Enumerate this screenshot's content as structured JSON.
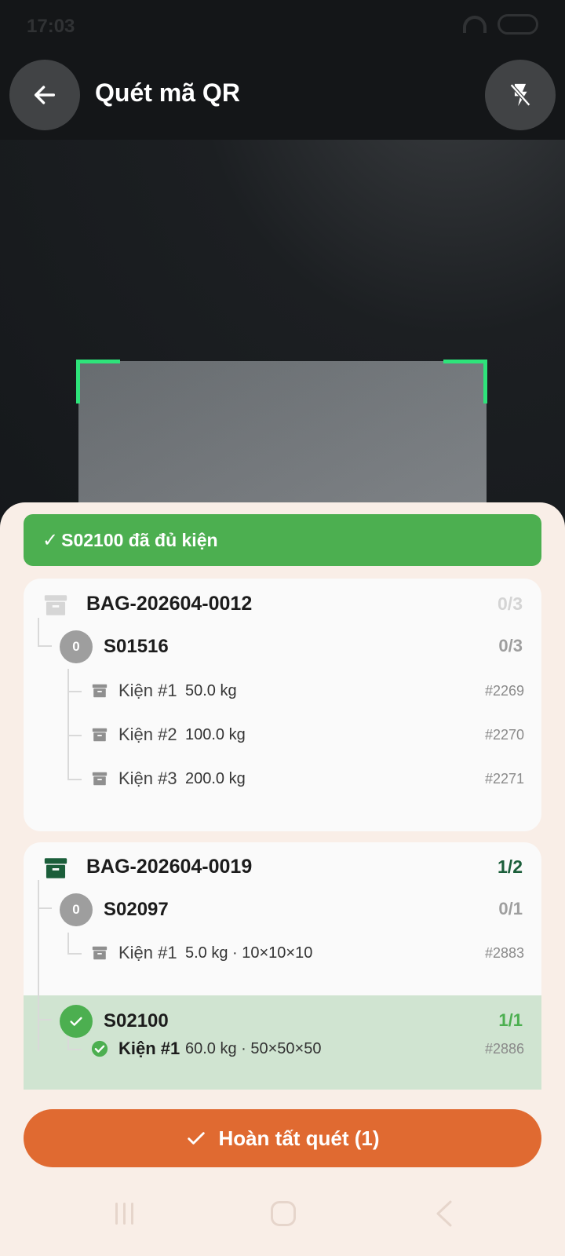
{
  "status_bar": {
    "time": "17:03"
  },
  "header": {
    "title": "Quét mã QR",
    "back_icon": "arrow-left-icon",
    "flash_icon": "flash-off-icon"
  },
  "scanner": {
    "frame_color": "#2ee37a"
  },
  "banner": {
    "icon": "check-icon",
    "text": "S02100 đã đủ kiện",
    "color": "#4caf50"
  },
  "bags": [
    {
      "code": "BAG-202604-0012",
      "count": "0/3",
      "orders": [
        {
          "code": "S01516",
          "badge": "0",
          "count": "0/3",
          "packages": [
            {
              "label": "Kiện #1",
              "detail": "50.0 kg",
              "id": "#2269"
            },
            {
              "label": "Kiện #2",
              "detail": "100.0 kg",
              "id": "#2270"
            },
            {
              "label": "Kiện #3",
              "detail": "200.0 kg",
              "id": "#2271"
            }
          ]
        }
      ]
    },
    {
      "code": "BAG-202604-0019",
      "count": "1/2",
      "orders": [
        {
          "code": "S02097",
          "badge": "0",
          "count": "0/1",
          "packages": [
            {
              "label": "Kiện #1",
              "detail": "5.0 kg · 10×10×10",
              "id": "#2883"
            }
          ]
        },
        {
          "code": "S02100",
          "badge": "check",
          "count": "1/1",
          "packages": [
            {
              "label": "Kiện #1",
              "detail": "60.0 kg · 50×50×50",
              "id": "#2886"
            }
          ]
        }
      ]
    }
  ],
  "finish_button": {
    "label": "Hoàn tất quét (1)",
    "color": "#e06a31"
  },
  "colors": {
    "accent_green": "#4caf50",
    "dark_green": "#1b5e3a",
    "sheet_bg": "#f9eee7",
    "highlight": "#d0e4d1"
  }
}
